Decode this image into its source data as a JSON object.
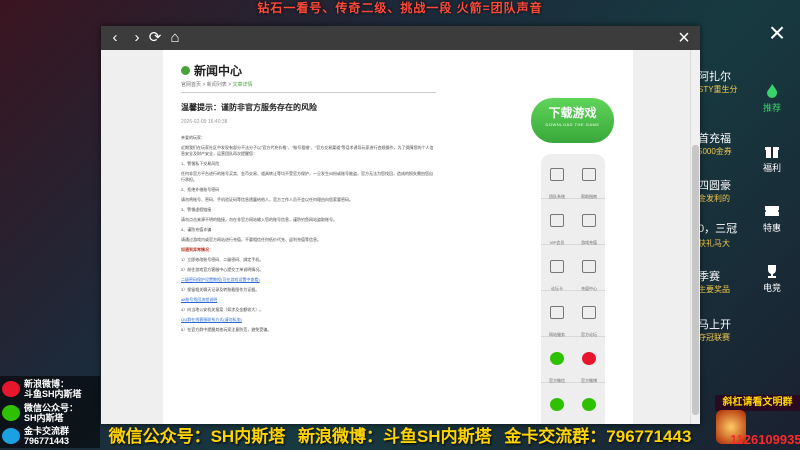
{
  "overlay": {
    "top_banner": "钻石一看号、传奇二级、挑战一段 火箭=团队声音",
    "bottom_banner": [
      "微信公众号：SH内斯塔",
      "新浪微博：斗鱼SH内斯塔",
      "金卡交流群：796771443"
    ],
    "close_glyph": "×",
    "social": [
      {
        "label": "新浪微博：",
        "value": "斗鱼SH内斯塔",
        "icon": "weibo-icon",
        "color": "#e6162d"
      },
      {
        "label": "微信公众号：",
        "value": "SH内斯塔",
        "icon": "wechat-icon",
        "color": "#2dc100"
      },
      {
        "label": "金卡交流群",
        "value": "796771443",
        "icon": "qq-icon",
        "color": "#1aa1e2"
      }
    ],
    "right_score": "斜杠请看文明群",
    "right_number": "1126109935"
  },
  "game_side": {
    "items": [
      {
        "label": "推荐",
        "icon": "fire-icon",
        "active": true
      },
      {
        "label": "福利",
        "icon": "gift-icon",
        "active": false
      },
      {
        "label": "特惠",
        "icon": "ticket-icon",
        "active": false
      },
      {
        "label": "电竞",
        "icon": "trophy-icon",
        "active": false
      }
    ],
    "strip": [
      {
        "text": "阿扎尔",
        "yellow": false
      },
      {
        "text": "STY重生分",
        "yellow": true
      },
      {
        "text": "首充福",
        "yellow": false
      },
      {
        "text": "5000金券",
        "yellow": true
      },
      {
        "text": "四圆豪",
        "yellow": false
      },
      {
        "text": "金发利的",
        "yellow": true
      },
      {
        "text": "0，三冠",
        "yellow": false
      },
      {
        "text": "获礼马大",
        "yellow": true
      },
      {
        "text": "季赛",
        "yellow": false
      },
      {
        "text": "主要奖品",
        "yellow": true
      },
      {
        "text": "马上开",
        "yellow": false
      },
      {
        "text": "夺冠联赛",
        "yellow": true
      }
    ]
  },
  "browser": {
    "nav": {
      "back": "‹",
      "forward": "›",
      "refresh": "⟳",
      "home": "⌂"
    },
    "close": "×"
  },
  "page": {
    "section_title": "新闻中心",
    "breadcrumb": {
      "home": "官网首页",
      "sep": " > ",
      "list": "新闻列表",
      "current": "文章详情"
    },
    "article": {
      "title": "温馨提示：谨防非官方服务存在的风险",
      "date": "2026-02-09 16:40:38",
      "paragraphs": [
        {
          "text": "亲爱的玩家：",
          "style": "normal"
        },
        {
          "text": "近期我们在玩家社区中发现有部分不法分子以\"官方代充价格\"、\"账号租借\"、\"官方交易渠道\"等话术诱导玩家进行违规操作，为了保障您的个人信息安全及财产安全，运营团队再次提醒您：",
          "style": "normal"
        },
        {
          "text": "1、警惕私下交易风险",
          "style": "normal"
        },
        {
          "text": "任何非官方平台进行的账号买卖、金币交易、道具转让等均不受官方保护，一旦发生纠纷或账号被盗，官方无法为您找回，造成的损失需由您自行承担。",
          "style": "normal"
        },
        {
          "text": "2、拒绝外借账号密码",
          "style": "normal"
        },
        {
          "text": "请勿将账号、密码、手机验证码等信息透露给他人，官方工作人员不会以任何理由向您索要密码。",
          "style": "normal"
        },
        {
          "text": "3、警惕虚假链接",
          "style": "normal"
        },
        {
          "text": "请勿点击来源不明的链接，勿在非官方网站输入您的账号信息，谨防钓鱼网站盗取账号。",
          "style": "normal"
        },
        {
          "text": "4、谨防充值诈骗",
          "style": "normal"
        },
        {
          "text": "请通过游戏内或官方网站进行充值，不要相信任何低价代充、返利充值等信息。",
          "style": "normal"
        },
        {
          "text": "如遇到异常情况：",
          "style": "red"
        },
        {
          "text": "1）立即修改账号密码、二级密码、绑定手机。",
          "style": "normal"
        },
        {
          "text": "2）前往游戏官方客服中心提交工单说明情况。",
          "style": "normal"
        },
        {
          "text": "二级密码保护设置教程(可在游戏设置中查看)",
          "style": "link"
        },
        {
          "text": "3）保留相关聊天记录及转账截图作为证据。",
          "style": "normal"
        },
        {
          "text": "alt账号找回流程说明",
          "style": "link"
        },
        {
          "text": "4）向当地公安机关报案（如涉及金额较大）。",
          "style": "normal"
        },
        {
          "text": "QQ群在线客服联系方式(请勿私加)",
          "style": "link"
        },
        {
          "text": "5）在官方群中提醒其他玩家注意防范，避免受骗。",
          "style": "normal"
        }
      ]
    },
    "download": {
      "label": "下载游戏",
      "sub": "DOWNLOAD THE GAME"
    },
    "features": [
      {
        "label": "团队系统",
        "icon": "team-icon"
      },
      {
        "label": "帮助指南",
        "icon": "monitor-icon"
      },
      {
        "label": "VIP会员",
        "icon": "crown-icon"
      },
      {
        "label": "游戏充值",
        "icon": "coin-icon"
      },
      {
        "label": "论坛卡",
        "icon": "card-icon"
      },
      {
        "label": "充值中心",
        "icon": "mic-icon"
      },
      {
        "label": "网站服务",
        "icon": "wrench-icon"
      },
      {
        "label": "官方论坛",
        "icon": "chat-icon"
      },
      {
        "label": "官方微信",
        "icon": "wechat-icon"
      },
      {
        "label": "官方微博",
        "icon": "weibo-icon"
      },
      {
        "label": "",
        "icon": "clover-icon"
      },
      {
        "label": "",
        "icon": "baidu-icon"
      }
    ]
  }
}
